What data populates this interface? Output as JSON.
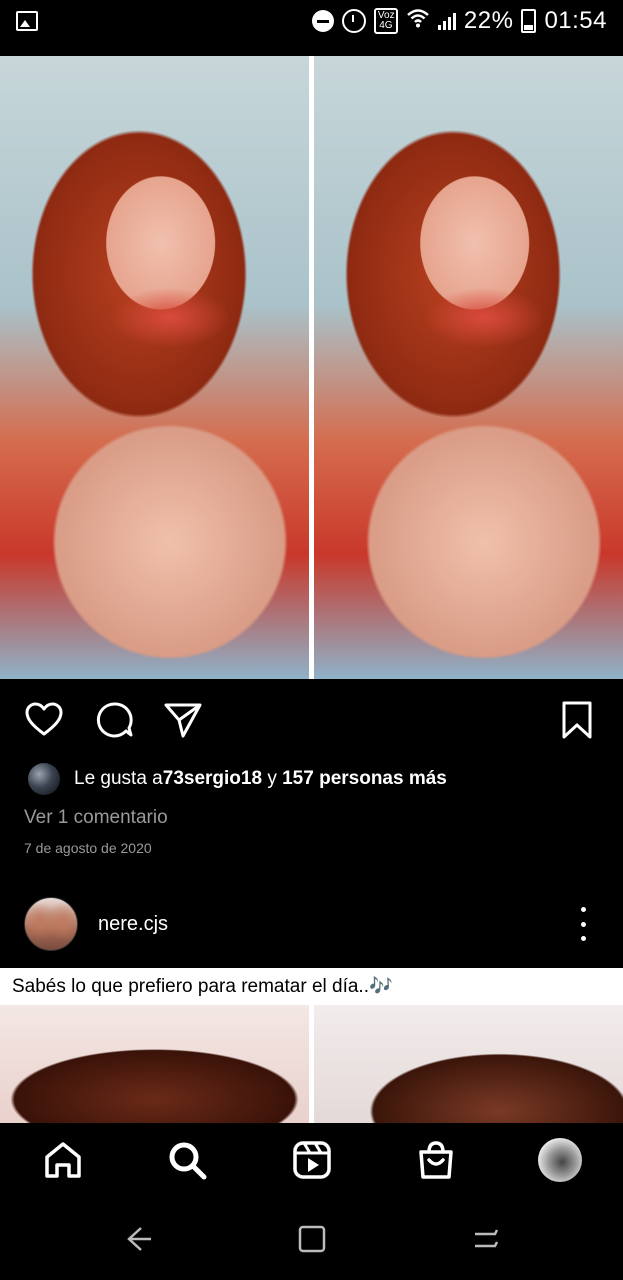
{
  "status_bar": {
    "icons": [
      "gallery-icon",
      "do-not-disturb-icon",
      "alarm-icon",
      "volte-icon",
      "wifi-icon",
      "signal-icon",
      "battery-icon"
    ],
    "volte_label": "Voz 4G",
    "battery_percent": "22%",
    "time": "01:54"
  },
  "post": {
    "likes": {
      "prefix": "Le gusta a ",
      "user": "73sergio18",
      "middle": " y ",
      "others": "157 personas más"
    },
    "comments_link": "Ver 1 comentario",
    "date": "7 de agosto de 2020",
    "actions": [
      "heart-icon",
      "comment-icon",
      "share-icon",
      "bookmark-icon"
    ]
  },
  "next_post": {
    "username": "nere.cjs",
    "caption": "Sabés lo que prefiero para rematar el día..🎶"
  },
  "bottom_nav": {
    "items": [
      "home-icon",
      "search-icon",
      "reels-icon",
      "shop-icon",
      "profile-avatar"
    ],
    "active": "search-icon"
  },
  "system_nav": [
    "back-icon",
    "home-square-icon",
    "recents-icon"
  ],
  "colors": {
    "background": "#000000",
    "text": "#ffffff",
    "muted": "#9a9a9a"
  }
}
